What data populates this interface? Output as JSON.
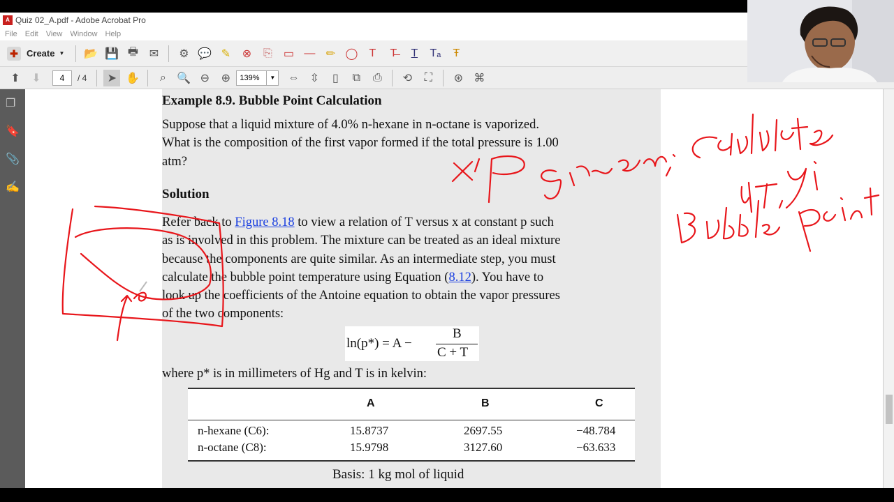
{
  "window": {
    "title": "Quiz 02_A.pdf - Adobe Acrobat Pro",
    "menu": [
      "File",
      "Edit",
      "View",
      "Window",
      "Help"
    ]
  },
  "toolbar": {
    "create_label": "Create",
    "page_current": "4",
    "page_total": "/ 4",
    "zoom": "139%"
  },
  "document": {
    "heading": "Example 8.9. Bubble Point Calculation",
    "problem_lines": [
      "Suppose that a liquid mixture of 4.0% n-hexane in n-octane is vaporized.",
      "What is the composition of the first vapor formed if the total pressure is 1.00",
      "atm?"
    ],
    "solution_heading": "Solution",
    "sol_line1_pre": "Refer back to ",
    "sol_line1_link": "Figure 8.18",
    "sol_line1_post": " to view a relation of T versus x at constant p such",
    "sol_line2": "as is involved in this problem. The mixture can be treated as an ideal mixture",
    "sol_line3": "because the components are quite similar. As an intermediate step, you must",
    "sol_line4_pre": "calculate the bubble point temperature using Equation (",
    "sol_line4_link": "8.12",
    "sol_line4_post": "). You have to",
    "sol_line5": "look up the coefficients of the Antoine equation to obtain the vapor pressures",
    "sol_line6": "of the two components:",
    "equation_lhs": "ln(p*) = A −",
    "equation_num": "B",
    "equation_den": "C + T",
    "where_text": "where p* is in millimeters of Hg and T is in kelvin:",
    "table": {
      "headers": [
        "A",
        "B",
        "C"
      ],
      "rows": [
        {
          "name": "n-hexane (C6):",
          "A": "15.8737",
          "B": "2697.55",
          "C": "−48.784"
        },
        {
          "name": "n-octane (C8):",
          "A": "15.9798",
          "B": "3127.60",
          "C": "−63.633"
        }
      ]
    },
    "basis": "Basis: 1 kg mol of liquid"
  }
}
